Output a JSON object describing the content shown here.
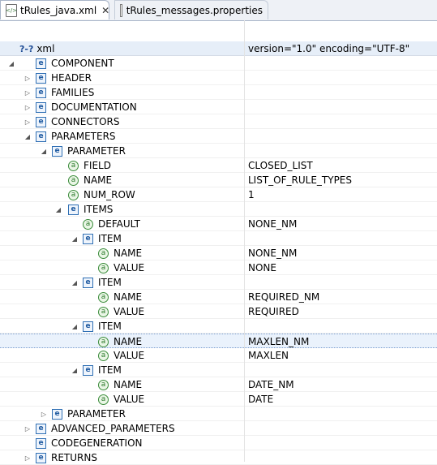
{
  "tabs": [
    {
      "label": "tRules_java.xml",
      "close": "✕"
    },
    {
      "label": "tRules_messages.properties"
    }
  ],
  "icons": {
    "element": "e",
    "attribute": "a",
    "pi": "?-?"
  },
  "tree": [
    {
      "name": "xml",
      "value": "version=\"1.0\" encoding=\"UTF-8\"",
      "kind": "pi",
      "tw": "",
      "header": true
    },
    {
      "name": "COMPONENT",
      "value": "",
      "kind": "e",
      "tw": "◢"
    },
    {
      "name": "HEADER",
      "value": "",
      "kind": "e",
      "tw": "▷"
    },
    {
      "name": "FAMILIES",
      "value": "",
      "kind": "e",
      "tw": "▷"
    },
    {
      "name": "DOCUMENTATION",
      "value": "",
      "kind": "e",
      "tw": "▷"
    },
    {
      "name": "CONNECTORS",
      "value": "",
      "kind": "e",
      "tw": "▷"
    },
    {
      "name": "PARAMETERS",
      "value": "",
      "kind": "e",
      "tw": "◢"
    },
    {
      "name": "PARAMETER",
      "value": "",
      "kind": "e",
      "tw": "◢"
    },
    {
      "name": "FIELD",
      "value": "CLOSED_LIST",
      "kind": "a",
      "tw": ""
    },
    {
      "name": "NAME",
      "value": "LIST_OF_RULE_TYPES",
      "kind": "a",
      "tw": ""
    },
    {
      "name": "NUM_ROW",
      "value": "1",
      "kind": "a",
      "tw": ""
    },
    {
      "name": "ITEMS",
      "value": "",
      "kind": "e",
      "tw": "◢"
    },
    {
      "name": "DEFAULT",
      "value": "NONE_NM",
      "kind": "a",
      "tw": ""
    },
    {
      "name": "ITEM",
      "value": "",
      "kind": "e",
      "tw": "◢"
    },
    {
      "name": "NAME",
      "value": "NONE_NM",
      "kind": "a",
      "tw": ""
    },
    {
      "name": "VALUE",
      "value": "NONE",
      "kind": "a",
      "tw": ""
    },
    {
      "name": "ITEM",
      "value": "",
      "kind": "e",
      "tw": "◢"
    },
    {
      "name": "NAME",
      "value": "REQUIRED_NM",
      "kind": "a",
      "tw": ""
    },
    {
      "name": "VALUE",
      "value": "REQUIRED",
      "kind": "a",
      "tw": ""
    },
    {
      "name": "ITEM",
      "value": "",
      "kind": "e",
      "tw": "◢"
    },
    {
      "name": "NAME",
      "value": "MAXLEN_NM",
      "kind": "a",
      "tw": "",
      "selected": true
    },
    {
      "name": "VALUE",
      "value": "MAXLEN",
      "kind": "a",
      "tw": ""
    },
    {
      "name": "ITEM",
      "value": "",
      "kind": "e",
      "tw": "◢"
    },
    {
      "name": "NAME",
      "value": "DATE_NM",
      "kind": "a",
      "tw": ""
    },
    {
      "name": "VALUE",
      "value": "DATE",
      "kind": "a",
      "tw": ""
    },
    {
      "name": "PARAMETER",
      "value": "",
      "kind": "e",
      "tw": "▷"
    },
    {
      "name": "ADVANCED_PARAMETERS",
      "value": "",
      "kind": "e",
      "tw": "▷"
    },
    {
      "name": "CODEGENERATION",
      "value": "",
      "kind": "e",
      "tw": ""
    },
    {
      "name": "RETURNS",
      "value": "",
      "kind": "e",
      "tw": "▷"
    }
  ]
}
